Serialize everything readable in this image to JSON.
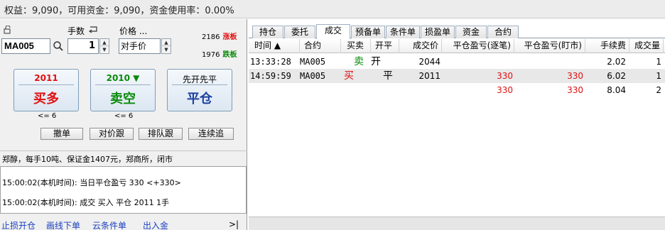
{
  "topbar": {
    "status": "权益：9,090，可用资金：9,090，资金使用率：0.00%"
  },
  "order": {
    "qty_label": "手数",
    "price_label": "价格 ...",
    "contract": "MA005",
    "quantity": "1",
    "price_type": "对手价",
    "upper_limit": {
      "value": "2186",
      "tag": "涨板"
    },
    "lower_limit": {
      "value": "1976",
      "tag": "跌板"
    },
    "buy": {
      "price": "2011",
      "action": "买多",
      "max": "<= 6"
    },
    "sell": {
      "price": "2010 ▼",
      "action": "卖空",
      "max": "<= 6"
    },
    "close": {
      "price": "先开先平",
      "action": "平仓"
    },
    "buttons": [
      "撤单",
      "对价跟",
      "排队跟",
      "连续追"
    ]
  },
  "info": {
    "text": "郑醇，每手10吨、保证金1407元，郑商所，闭市"
  },
  "log": [
    "15:00:02(本机时间): 当日平仓盈亏 330 <+330>",
    "15:00:02(本机时间): 成交 买入 平仓 2011 1手"
  ],
  "bottom_links": [
    "止损开仓",
    "画线下单",
    "云条件单",
    "出入金",
    ">|"
  ],
  "tabs": [
    "持仓",
    "委托",
    "成交",
    "预备单",
    "条件单",
    "损盈单",
    "资金",
    "合约"
  ],
  "active_tab": "成交",
  "table": {
    "headers": [
      "时间 ▲",
      "合约",
      "买卖",
      "开平",
      "成交价",
      "平仓盈亏(逐笔)",
      "平仓盈亏(盯市)",
      "手续费",
      "成交量"
    ],
    "rows": [
      {
        "time": "13:33:28",
        "contract": "MA005",
        "side": "卖",
        "openclose": "开",
        "price": "2044",
        "pnl_trade": "",
        "pnl_mark": "",
        "fee": "2.02",
        "vol": "1"
      },
      {
        "time": "14:59:59",
        "contract": "MA005",
        "side": "买",
        "openclose": "平",
        "price": "2011",
        "pnl_trade": "330",
        "pnl_mark": "330",
        "fee": "6.02",
        "vol": "1"
      }
    ],
    "total": {
      "pnl_trade": "330",
      "pnl_mark": "330",
      "fee": "8.04",
      "vol": "2"
    }
  },
  "colors": {
    "up": "#e01010",
    "down": "#0a8a0a",
    "accent": "#1a3fbf"
  }
}
